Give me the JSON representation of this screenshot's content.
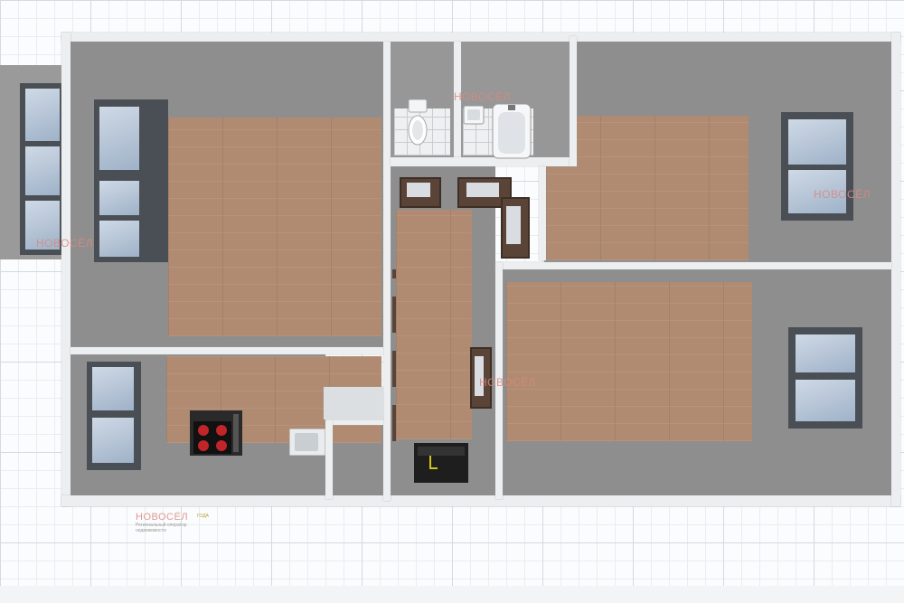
{
  "watermark": {
    "brand": "НОВОСЁЛ",
    "tagline": "Региональный оператор недвижимости",
    "badge": "ГОДА"
  },
  "icons": [
    "toilet-icon",
    "bathtub-icon",
    "sink-icon",
    "stove-icon",
    "washer-icon"
  ],
  "colors": {
    "wall": "#eceef0",
    "floor_gray": "#8e8e8e",
    "wood": "#b08b72",
    "watermark": "#d8897f"
  }
}
